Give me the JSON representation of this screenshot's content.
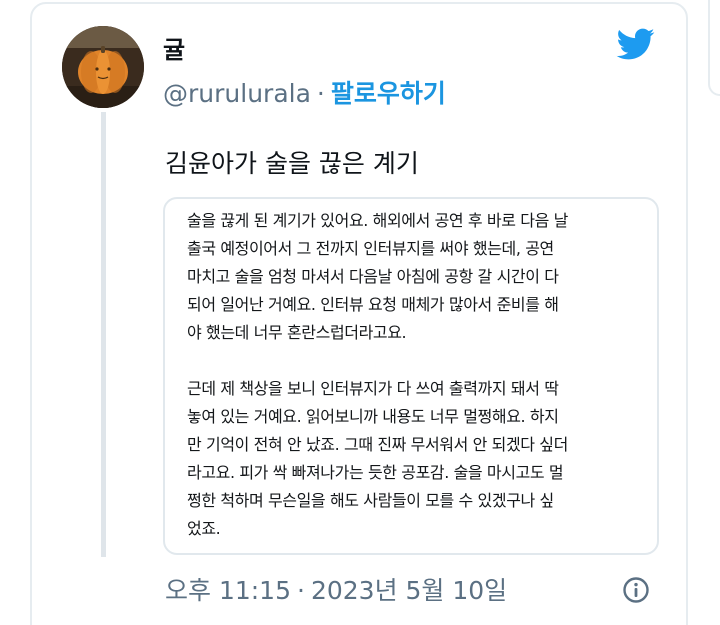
{
  "tweet": {
    "display_name": "귤",
    "handle": "@rurulurala",
    "separator": "·",
    "follow_label": "팔로우하기",
    "text": "김윤아가 술을 끊은 계기",
    "brand_icon": "twitter-bird-icon",
    "brand_color": "#1d9bf0",
    "timestamp": {
      "time": "오후 11:15",
      "separator": "·",
      "date": "2023년 5월 10일"
    },
    "info_icon": "info-icon"
  },
  "quote": {
    "paragraphs": [
      [
        "술을 끊게 된 계기가 있어요. 해외에서 공연 후 바로 다음 날",
        "출국 예정이어서 그 전까지 인터뷰지를 써야 했는데, 공연",
        "마치고 술을 엄청 마셔서 다음날 아침에 공항 갈 시간이 다",
        "되어 일어난 거예요. 인터뷰 요청 매체가 많아서 준비를 해",
        "야 했는데 너무 혼란스럽더라고요."
      ],
      [
        "근데 제 책상을 보니 인터뷰지가 다 쓰여 출력까지 돼서 딱",
        "놓여 있는 거예요. 읽어보니까 내용도 너무 멀쩡해요. 하지",
        "만 기억이 전혀 안 났죠. 그때 진짜 무서워서 안 되겠다 싶더",
        "라고요. 피가 싹 빠져나가는 듯한 공포감. 술을 마시고도 멀",
        "쩡한 척하며 무슨일을 해도 사람들이 모를 수 있겠구나 싶",
        "었죠."
      ]
    ]
  }
}
